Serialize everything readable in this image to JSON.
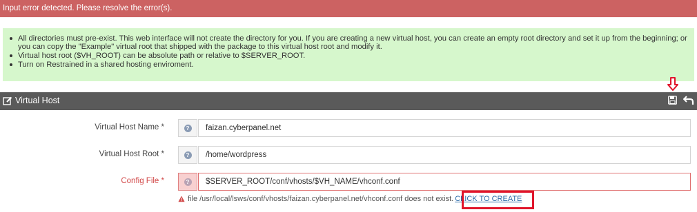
{
  "alert": {
    "error_text": "Input error detected. Please resolve the error(s)."
  },
  "info": {
    "items": [
      "All directories must pre-exist. This web interface will not create the directory for you. If you are creating a new virtual host, you can create an empty root directory and set it up from the beginning; or you can copy the \"Example\" virtual root that shipped with the package to this virtual host root and modify it.",
      "Virtual host root ($VH_ROOT) can be absolute path or relative to $SERVER_ROOT.",
      "Turn on Restrained in a shared hosting enviroment."
    ]
  },
  "panel": {
    "title": "Virtual Host",
    "save_icon": "save-icon",
    "undo_icon": "undo-icon",
    "edit_icon": "edit-icon"
  },
  "form": {
    "name": {
      "label": "Virtual Host Name *",
      "value": "faizan.cyberpanel.net"
    },
    "root": {
      "label": "Virtual Host Root *",
      "value": "/home/wordpress"
    },
    "config": {
      "label": "Config File *",
      "value": "$SERVER_ROOT/conf/vhosts/$VH_NAME/vhconf.conf"
    }
  },
  "error": {
    "message": "file /usr/local/lsws/conf/vhosts/faizan.cyberpanel.net/vhconf.conf does not exist.",
    "link_text": "CLICK TO CREATE"
  },
  "colors": {
    "error_bar": "#cc6262",
    "info_bg": "#d6f7cc",
    "header_bg": "#5a5a5a",
    "annotation_red": "#e0152b"
  }
}
